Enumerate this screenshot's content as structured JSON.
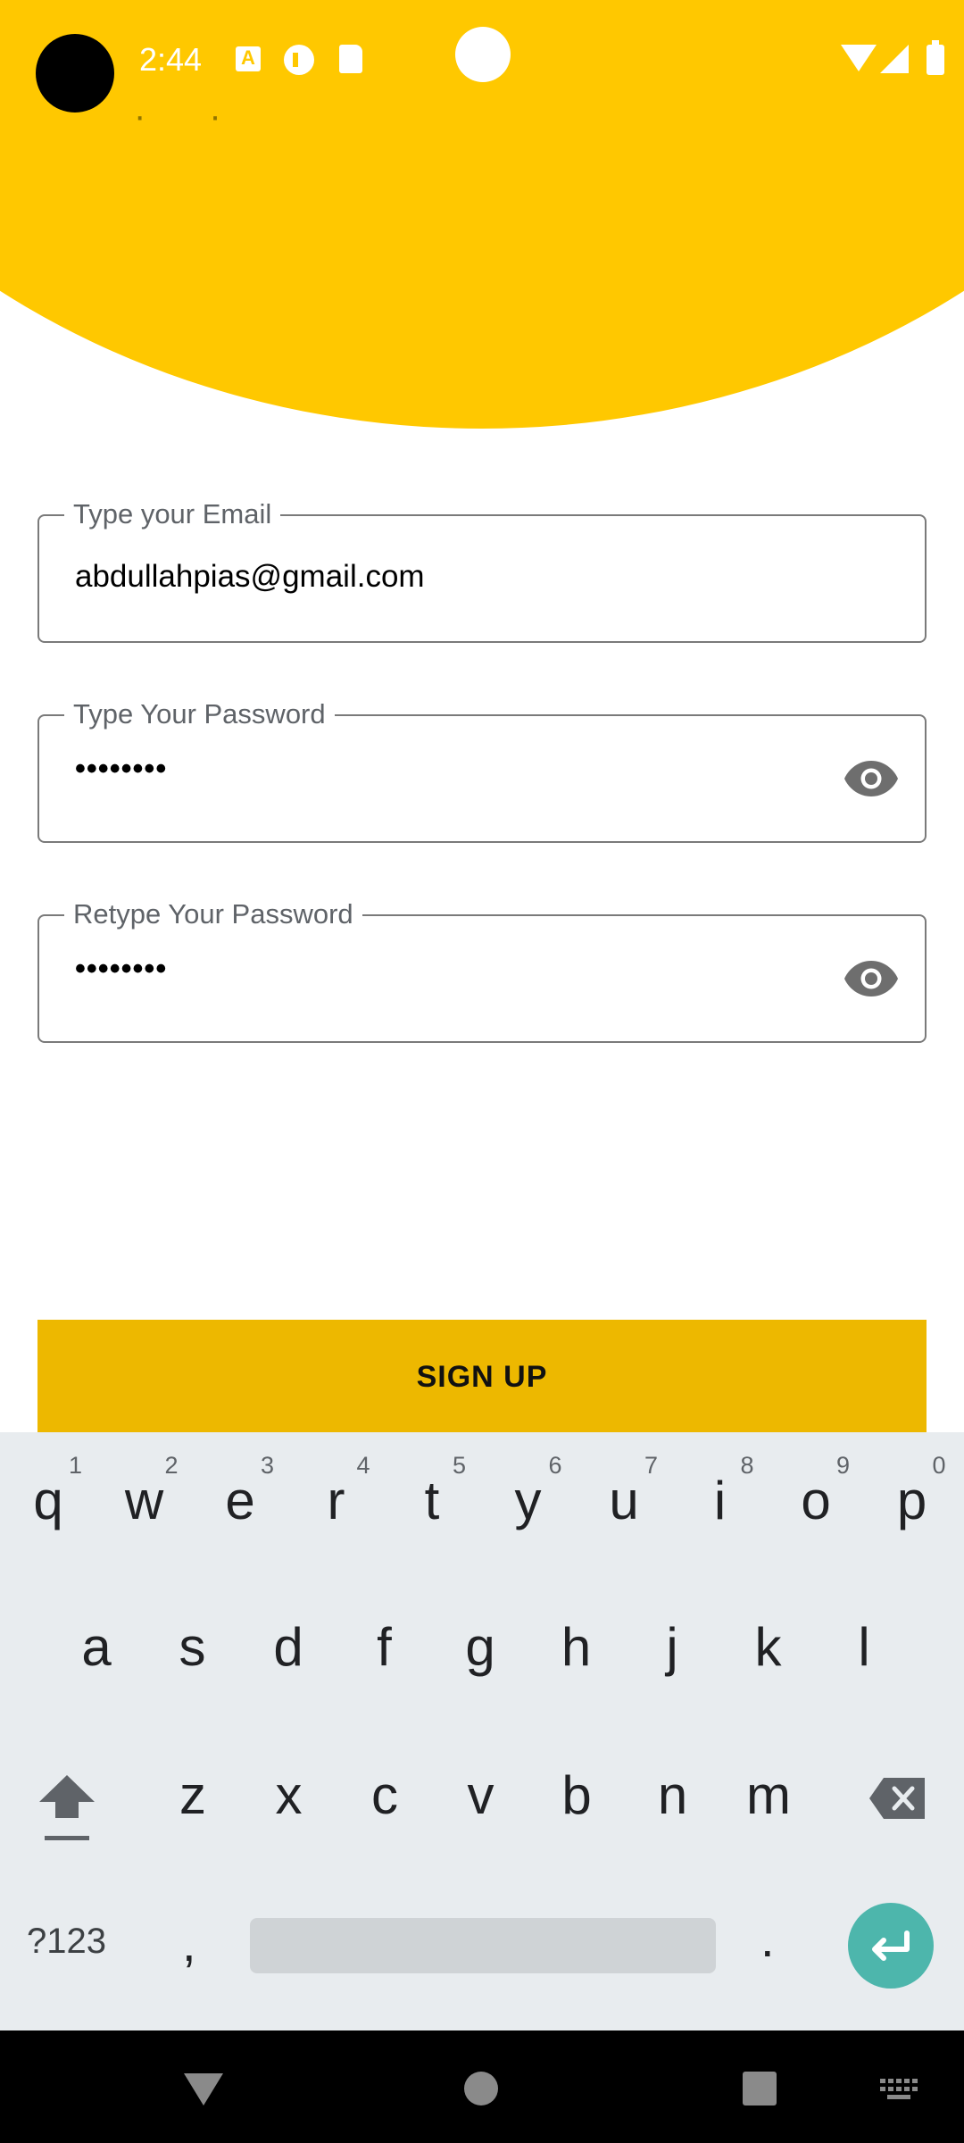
{
  "status_bar": {
    "time": "2:44"
  },
  "header": {
    "partial_title": "· · ·"
  },
  "form": {
    "email": {
      "label": "Type your Email",
      "value": "abdullahpias@gmail.com"
    },
    "password": {
      "label": "Type Your Password",
      "value": "••••••••"
    },
    "retype_password": {
      "label": "Retype Your Password",
      "value": "••••••••"
    },
    "signup_label": "SIGN UP"
  },
  "colors": {
    "header": "#FFC800",
    "button": "#EDB800",
    "enter": "#4DB6AC",
    "keyboard_bg": "#E8ECEF"
  },
  "keyboard": {
    "row1": [
      {
        "ch": "q",
        "hint": "1"
      },
      {
        "ch": "w",
        "hint": "2"
      },
      {
        "ch": "e",
        "hint": "3"
      },
      {
        "ch": "r",
        "hint": "4"
      },
      {
        "ch": "t",
        "hint": "5"
      },
      {
        "ch": "y",
        "hint": "6"
      },
      {
        "ch": "u",
        "hint": "7"
      },
      {
        "ch": "i",
        "hint": "8"
      },
      {
        "ch": "o",
        "hint": "9"
      },
      {
        "ch": "p",
        "hint": "0"
      }
    ],
    "row2": [
      "a",
      "s",
      "d",
      "f",
      "g",
      "h",
      "j",
      "k",
      "l"
    ],
    "row3": [
      "z",
      "x",
      "c",
      "v",
      "b",
      "n",
      "m"
    ],
    "symbols_label": "?123",
    "comma": ",",
    "period": "."
  },
  "icons": {
    "password_toggle": "eye-icon",
    "shift": "shift-icon",
    "backspace": "backspace-icon",
    "enter": "enter-icon"
  }
}
